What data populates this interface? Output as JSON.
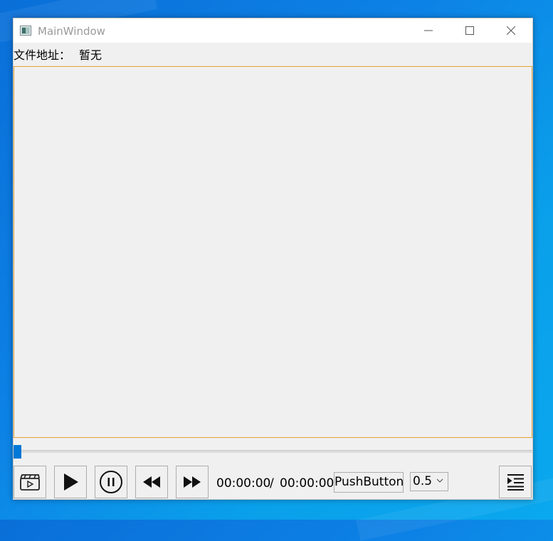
{
  "window": {
    "title": "MainWindow"
  },
  "file_path": {
    "label": "文件地址：",
    "value": "暂无"
  },
  "progress": {
    "value_fraction": 0.0
  },
  "controls": {
    "open_icon": "clapperboard-icon",
    "play_icon": "play-icon",
    "pause_icon": "pause-circle-icon",
    "rewind_icon": "rewind-icon",
    "forward_icon": "fast-forward-icon",
    "current_time": "00:00:00",
    "separator": "/",
    "total_time": "00:00:00",
    "push_button_label": "PushButton",
    "speed_value": "0.5",
    "playlist_icon": "playlist-indent-icon"
  },
  "colors": {
    "accent": "#0078d7",
    "video_border": "#e3a23c"
  }
}
